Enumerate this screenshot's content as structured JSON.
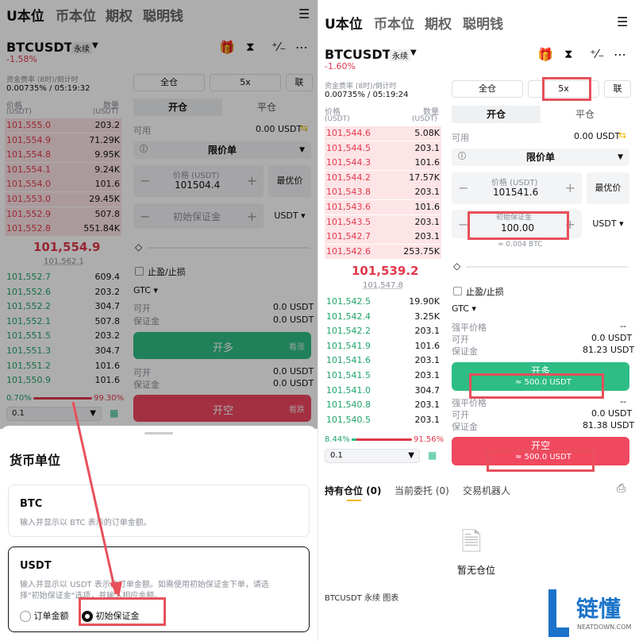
{
  "nav": {
    "tabs": [
      "U本位",
      "币本位",
      "期权",
      "聪明钱"
    ]
  },
  "left": {
    "symbol": "BTCUSDT",
    "contract": "永续",
    "change": "-1.58%",
    "funding_label": "资金费率 (8时)/倒计时",
    "funding_value": "0.00735% / 05:19:32",
    "ob_price_label": "价格",
    "ob_qty_label": "数量",
    "ob_unit": "(USDT)",
    "asks": [
      [
        "101,555.0",
        "203.2"
      ],
      [
        "101,554.9",
        "71.29K"
      ],
      [
        "101,554.8",
        "9.95K"
      ],
      [
        "101,554.1",
        "9.24K"
      ],
      [
        "101,554.0",
        "101.6"
      ],
      [
        "101,553.0",
        "29.45K"
      ],
      [
        "101,552.9",
        "507.8"
      ],
      [
        "101,552.8",
        "551.84K"
      ]
    ],
    "mid_price": "101,554.9",
    "mark_price": "101,562.1",
    "bids": [
      [
        "101,552.7",
        "609.4"
      ],
      [
        "101,552.6",
        "203.2"
      ],
      [
        "101,552.2",
        "304.7"
      ],
      [
        "101,552.1",
        "507.8"
      ],
      [
        "101,551.5",
        "203.2"
      ],
      [
        "101,551.3",
        "304.7"
      ],
      [
        "101,551.2",
        "101.6"
      ],
      [
        "101,550.9",
        "101.6"
      ]
    ],
    "ratio_buy": "0.70%",
    "ratio_sell": "99.30%",
    "precision": "0.1",
    "margin_mode": "全仓",
    "leverage": "5x",
    "link": "联",
    "open_tab": "开仓",
    "close_tab": "平仓",
    "avail_label": "可用",
    "avail_value": "0.00 USDT",
    "order_type": "限价单",
    "price_label": "价格 (USDT)",
    "price_value": "101504.4",
    "best_price": "最优价",
    "margin_placeholder": "初始保证金",
    "unit": "USDT",
    "tpsl": "止盈/止损",
    "tif": "GTC",
    "can_open": "可开",
    "can_open_val": "0.0 USDT",
    "margin_label": "保证金",
    "margin_val": "0.0 USDT",
    "long_btn": "开多",
    "long_hint": "看涨",
    "can_open2_val": "0.0 USDT",
    "margin2_val": "0.0 USDT",
    "short_btn": "开空",
    "short_hint": "看跌"
  },
  "sheet": {
    "title": "货币单位",
    "btc_title": "BTC",
    "btc_desc": "输入并显示以 BTC 表示的订单金额。",
    "usdt_title": "USDT",
    "usdt_desc1": "输入并显示以 USDT 表示的订单金额。如需使用初始保证金下单，请选",
    "usdt_desc2": "择\"初始保证金\"选项，并输入相应金额。",
    "opt_order": "订单金额",
    "opt_margin": "初始保证金"
  },
  "right": {
    "symbol": "BTCUSDT",
    "contract": "永续",
    "change": "-1.60%",
    "funding_label": "资金费率 (8时)/倒计时",
    "funding_value": "0.00735% / 05:19:24",
    "ob_price_label": "价格",
    "ob_qty_label": "数量",
    "ob_unit": "(USDT)",
    "asks": [
      [
        "101,544.6",
        "5.08K"
      ],
      [
        "101,544.5",
        "203.1"
      ],
      [
        "101,544.3",
        "101.6"
      ],
      [
        "101,544.2",
        "17.57K"
      ],
      [
        "101,543.8",
        "203.1"
      ],
      [
        "101,543.6",
        "101.6"
      ],
      [
        "101,543.5",
        "203.1"
      ],
      [
        "101,542.7",
        "203.1"
      ],
      [
        "101,542.6",
        "253.75K"
      ]
    ],
    "mid_price": "101,539.2",
    "mark_price": "101,547.8",
    "bids": [
      [
        "101,542.5",
        "19.90K"
      ],
      [
        "101,542.4",
        "3.25K"
      ],
      [
        "101,542.2",
        "203.1"
      ],
      [
        "101,541.9",
        "101.6"
      ],
      [
        "101,541.6",
        "203.1"
      ],
      [
        "101,541.5",
        "203.1"
      ],
      [
        "101,541.0",
        "304.7"
      ],
      [
        "101,540.8",
        "203.1"
      ],
      [
        "101,540.5",
        "203.1"
      ]
    ],
    "ratio_buy": "8.44%",
    "ratio_sell": "91.56%",
    "precision": "0.1",
    "margin_mode": "全仓",
    "leverage": "5x",
    "link": "联",
    "open_tab": "开仓",
    "close_tab": "平仓",
    "avail_label": "可用",
    "avail_value": "0.00 USDT",
    "order_type": "限价单",
    "price_label": "价格 (USDT)",
    "price_value": "101541.6",
    "best_price": "最优价",
    "margin_label_in": "初始保证金",
    "margin_value": "100.00",
    "unit": "USDT",
    "btc_equiv": "≈ 0.004 BTC",
    "tpsl": "止盈/止损",
    "tif": "GTC",
    "liq_label": "强平价格",
    "liq_val": "--",
    "can_open": "可开",
    "can_open_val": "0.0 USDT",
    "margin_label": "保证金",
    "margin_val": "81.23 USDT",
    "long_btn": "开多",
    "long_sub": "≈ 500.0 USDT",
    "liq2_val": "--",
    "can_open2_val": "0.0 USDT",
    "margin2_val": "81.38 USDT",
    "short_btn": "开空",
    "short_sub": "≈ 500.0 USDT",
    "bottom_tabs": [
      "持有仓位 (0)",
      "当前委托 (0)",
      "交易机器人"
    ],
    "empty": "暂无仓位",
    "footer_text": "BTCUSDT 永续 图表"
  },
  "watermark": {
    "cn": "链懂",
    "en": "NEATDOWN.COM"
  },
  "colors": {
    "accent_red": "#e0384b",
    "accent_green": "#2ebd85",
    "highlight": "#e8505b",
    "brand_yellow": "#f0b90b"
  }
}
